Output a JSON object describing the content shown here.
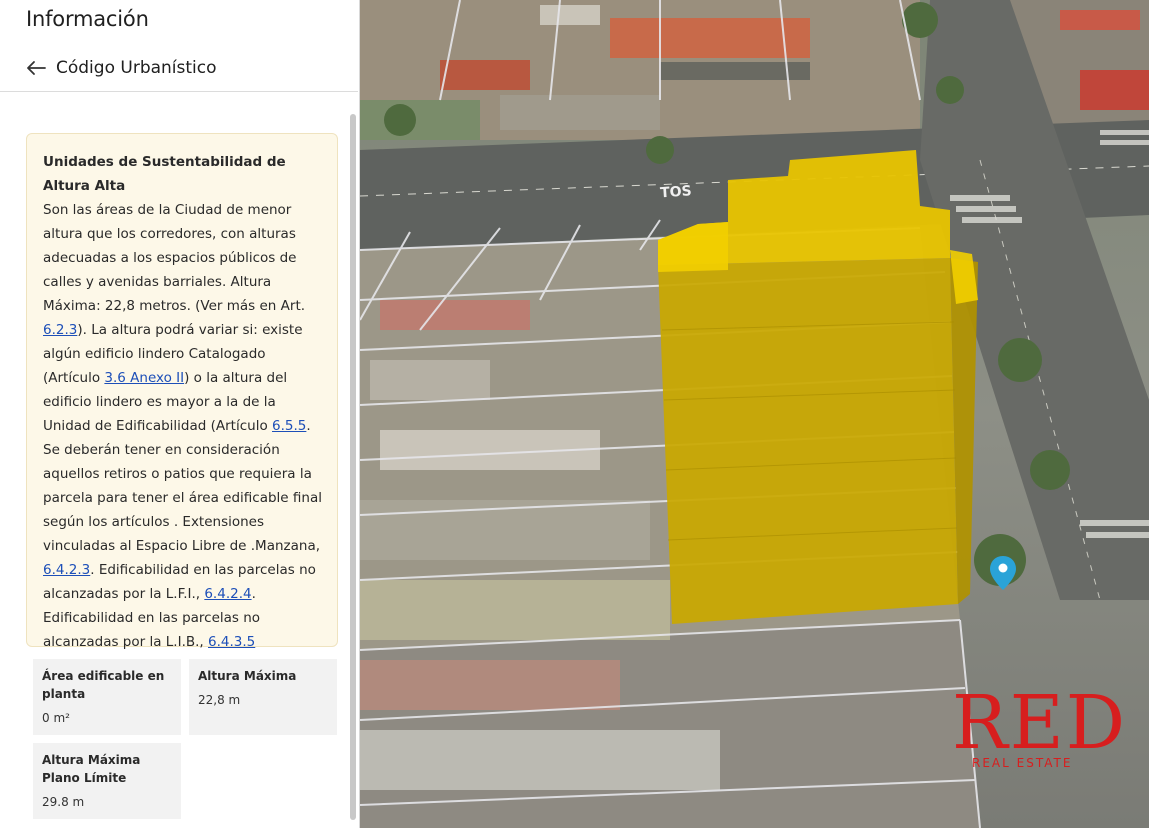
{
  "panel": {
    "title": "Información",
    "section_title": "Código Urbanístico"
  },
  "info": {
    "title": "Unidades de Sustentabilidad de Altura Alta",
    "text_1": "Son las áreas de la Ciudad de menor altura que los corredores, con alturas adecuadas a los espacios públicos de calles y avenidas barriales. Altura Máxima: 22,8 metros. (Ver más en Art. ",
    "link_1": "6.2.3",
    "text_2": "). La altura podrá variar si: existe algún edificio lindero Catalogado (Artículo ",
    "link_2": "3.6 Anexo II",
    "text_3": ") o la altura del edificio lindero es mayor a la de la Unidad de Edificabilidad (Artículo ",
    "link_3": "6.5.5",
    "text_4": ". Se deberán tener en consideración aquellos retiros o patios que requiera la parcela para tener el área edificable final según los artículos . Extensiones vinculadas al Espacio Libre de .Manzana, ",
    "link_4": "6.4.2.3",
    "text_5": ". Edificabilidad en las parcelas no alcanzadas por la L.F.I., ",
    "link_5": "6.4.2.4",
    "text_6": ". Edificabilidad en las parcelas no alcanzadas por la L.I.B., ",
    "link_6": "6.4.3.5"
  },
  "stats": [
    {
      "label": "Área edificable en planta",
      "value": "0 m²"
    },
    {
      "label": "Altura Máxima",
      "value": "22,8 m"
    },
    {
      "label": "Altura Máxima Plano Límite",
      "value": "29.8 m"
    }
  ],
  "map": {
    "street_label": "TOS",
    "building_color": "#e8c400",
    "marker_color": "#2aa3d8",
    "icons": [
      "back-arrow-icon",
      "location-pin-icon"
    ]
  },
  "watermark": {
    "brand": "RED",
    "sub": "REAL ESTATE",
    "color": "#d71e1e"
  }
}
